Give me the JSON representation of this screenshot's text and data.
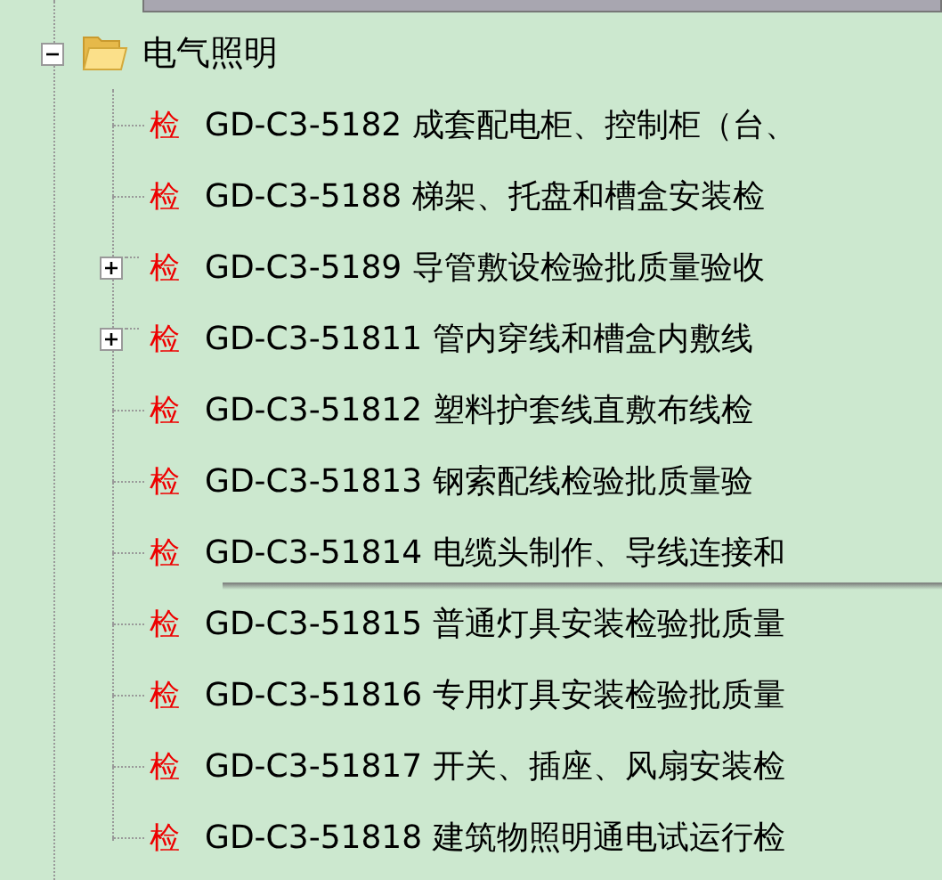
{
  "tree": {
    "label": "电气照明",
    "expanded": true,
    "children": [
      {
        "badge": "检",
        "label": "GD-C3-5182 成套配电柜、控制柜（台、",
        "expandable": false
      },
      {
        "badge": "检",
        "label": "GD-C3-5188 梯架、托盘和槽盒安装检",
        "expandable": false
      },
      {
        "badge": "检",
        "label": "GD-C3-5189 导管敷设检验批质量验收",
        "expandable": true
      },
      {
        "badge": "检",
        "label": "GD-C3-51811 管内穿线和槽盒内敷线",
        "expandable": true
      },
      {
        "badge": "检",
        "label": "GD-C3-51812 塑料护套线直敷布线检",
        "expandable": false
      },
      {
        "badge": "检",
        "label": "GD-C3-51813 钢索配线检验批质量验",
        "expandable": false
      },
      {
        "badge": "检",
        "label": "GD-C3-51814 电缆头制作、导线连接和",
        "expandable": false
      },
      {
        "badge": "检",
        "label": "GD-C3-51815 普通灯具安装检验批质量",
        "expandable": false
      },
      {
        "badge": "检",
        "label": "GD-C3-51816 专用灯具安装检验批质量",
        "expandable": false
      },
      {
        "badge": "检",
        "label": "GD-C3-51817 开关、插座、风扇安装检",
        "expandable": false
      },
      {
        "badge": "检",
        "label": "GD-C3-51818 建筑物照明通电试运行检",
        "expandable": false
      }
    ]
  }
}
